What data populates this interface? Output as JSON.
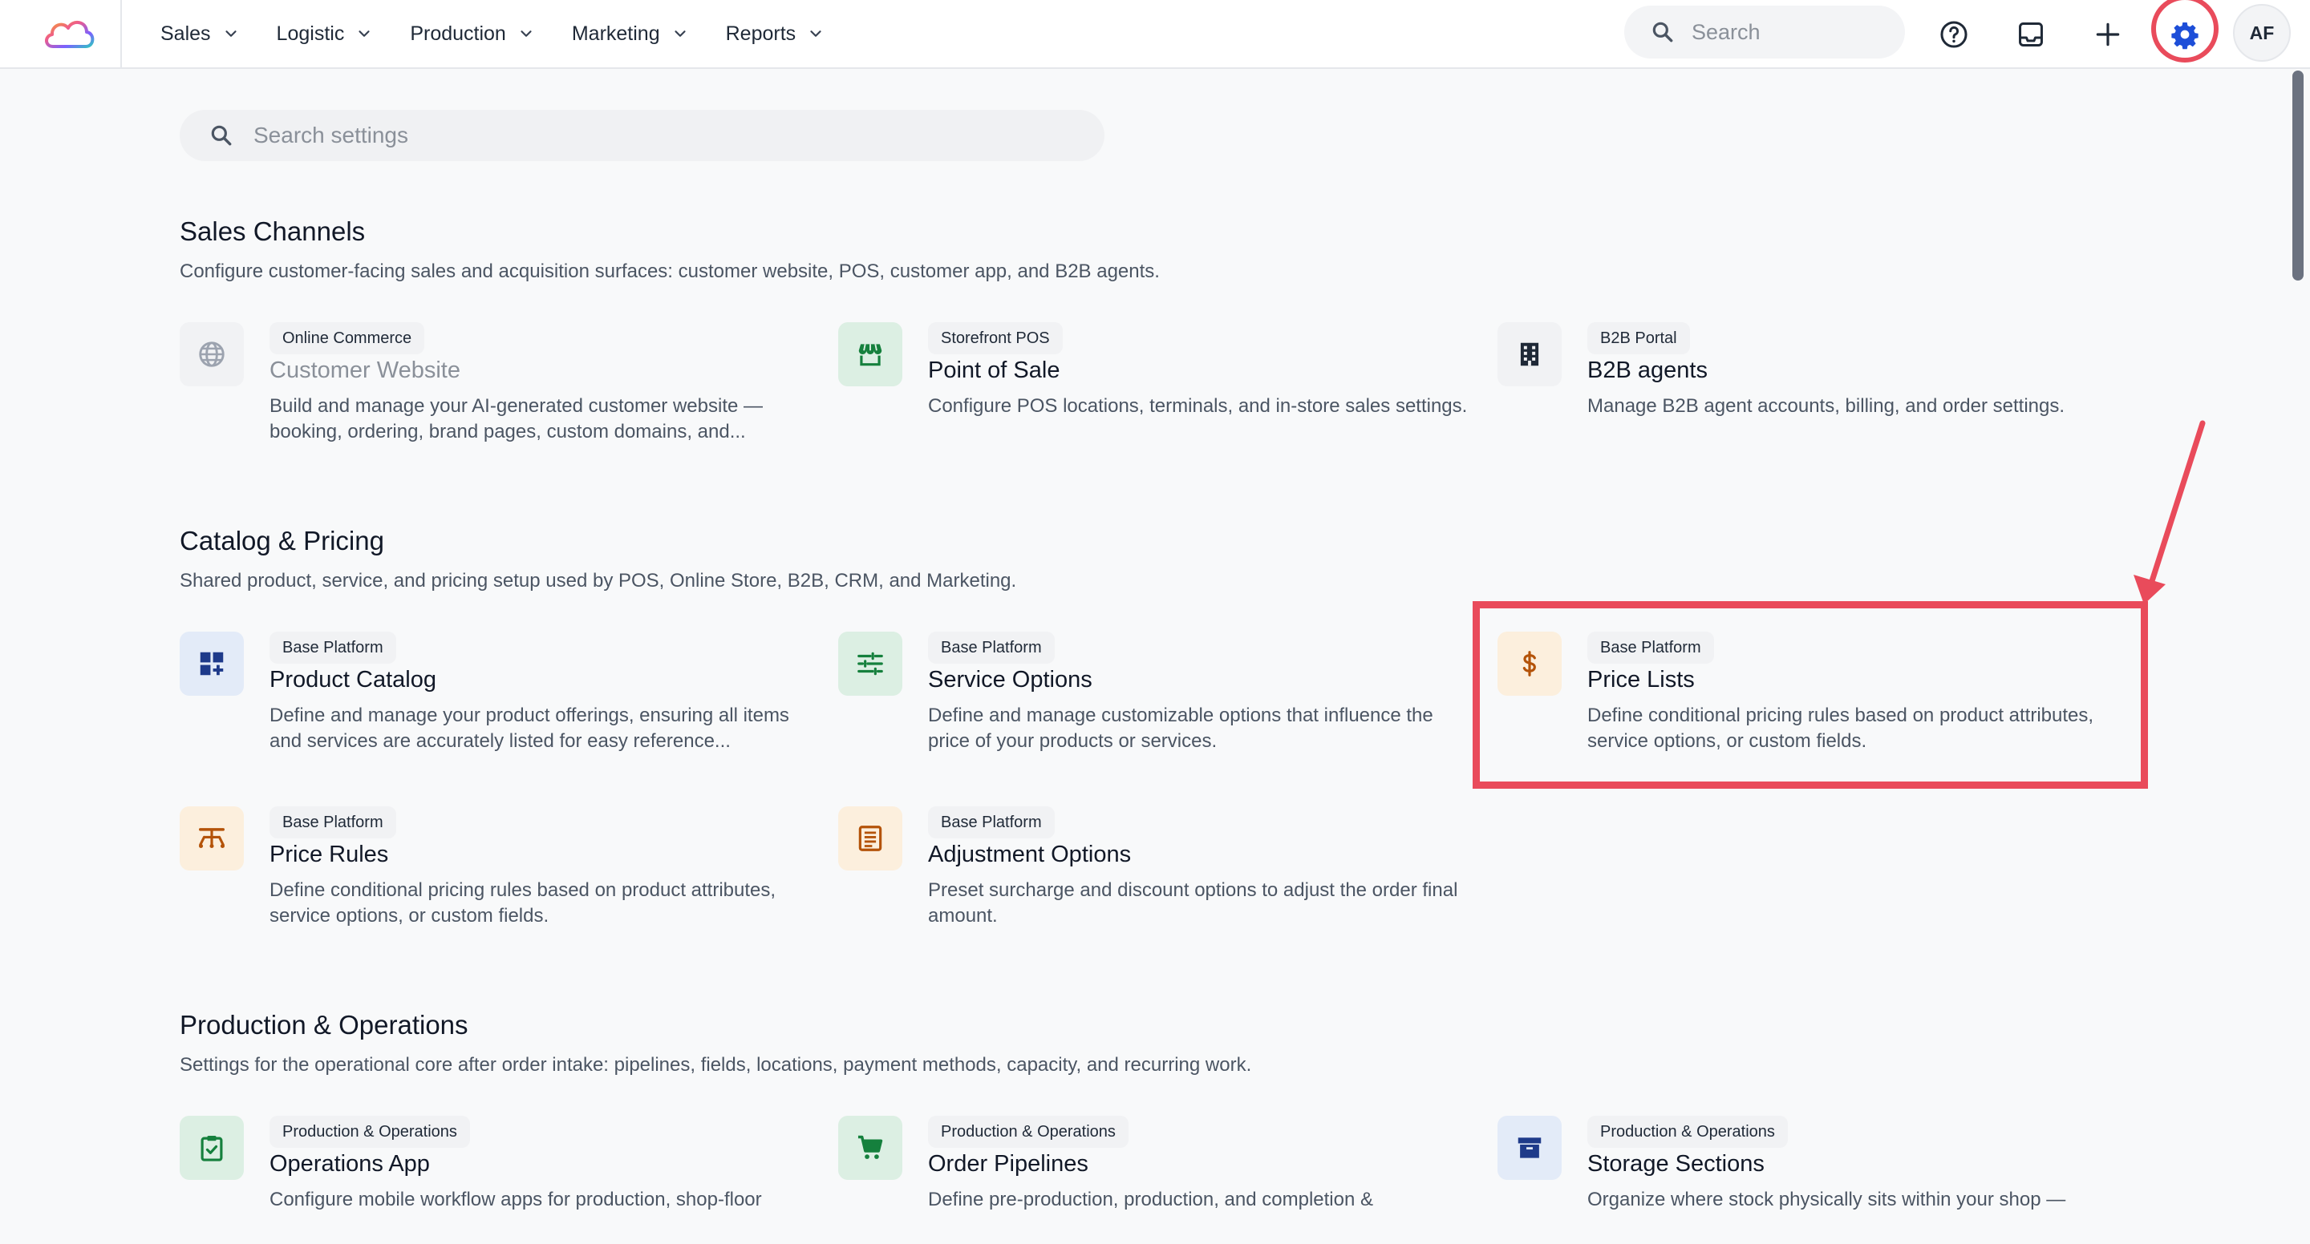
{
  "topbar": {
    "nav": [
      {
        "label": "Sales"
      },
      {
        "label": "Logistic"
      },
      {
        "label": "Production"
      },
      {
        "label": "Marketing"
      },
      {
        "label": "Reports"
      }
    ],
    "search_placeholder": "Search",
    "avatar_initials": "AF"
  },
  "settings_search_placeholder": "Search settings",
  "sections": [
    {
      "title": "Sales Channels",
      "description": "Configure customer-facing sales and acquisition surfaces: customer website, POS, customer app, and B2B agents.",
      "cards": [
        {
          "badge": "Online Commerce",
          "title": "Customer Website",
          "description": "Build and manage your AI-generated customer website — booking, ordering, brand pages, custom domains, and...",
          "icon": "globe-icon",
          "disabled": true
        },
        {
          "badge": "Storefront POS",
          "title": "Point of Sale",
          "description": "Configure POS locations, terminals, and in-store sales settings.",
          "icon": "storefront-icon"
        },
        {
          "badge": "B2B Portal",
          "title": "B2B agents",
          "description": "Manage B2B agent accounts, billing, and order settings.",
          "icon": "building-icon"
        }
      ]
    },
    {
      "title": "Catalog & Pricing",
      "description": "Shared product, service, and pricing setup used by POS, Online Store, B2B, CRM, and Marketing.",
      "cards": [
        {
          "badge": "Base Platform",
          "title": "Product Catalog",
          "description": "Define and manage your product offerings, ensuring all items and services are accurately listed for easy reference...",
          "icon": "grid-plus-icon"
        },
        {
          "badge": "Base Platform",
          "title": "Service Options",
          "description": "Define and manage customizable options that influence the price of your products or services.",
          "icon": "sliders-icon"
        },
        {
          "badge": "Base Platform",
          "title": "Price Lists",
          "description": "Define conditional pricing rules based on product attributes, service options, or custom fields.",
          "icon": "dollar-icon"
        },
        {
          "badge": "Base Platform",
          "title": "Price Rules",
          "description": "Define conditional pricing rules based on product attributes, service options, or custom fields.",
          "icon": "price-rules-icon"
        },
        {
          "badge": "Base Platform",
          "title": "Adjustment Options",
          "description": "Preset surcharge and discount options to adjust the order final amount.",
          "icon": "list-icon"
        }
      ]
    },
    {
      "title": "Production & Operations",
      "description": "Settings for the operational core after order intake: pipelines, fields, locations, payment methods, capacity, and recurring work.",
      "cards": [
        {
          "badge": "Production & Operations",
          "title": "Operations App",
          "description": "Configure mobile workflow apps for production, shop-floor",
          "icon": "clipboard-check-icon"
        },
        {
          "badge": "Production & Operations",
          "title": "Order Pipelines",
          "description": "Define pre-production, production, and completion &",
          "icon": "cart-icon"
        },
        {
          "badge": "Production & Operations",
          "title": "Storage Sections",
          "description": "Organize where stock physically sits within your shop —",
          "icon": "archive-icon"
        }
      ]
    }
  ],
  "colors": {
    "accent_blue": "#1d4ed8",
    "annotation_red": "#e94b5b",
    "green_icon": "#15803d",
    "orange_icon": "#b45309",
    "navy_icon": "#1e3a8a"
  }
}
